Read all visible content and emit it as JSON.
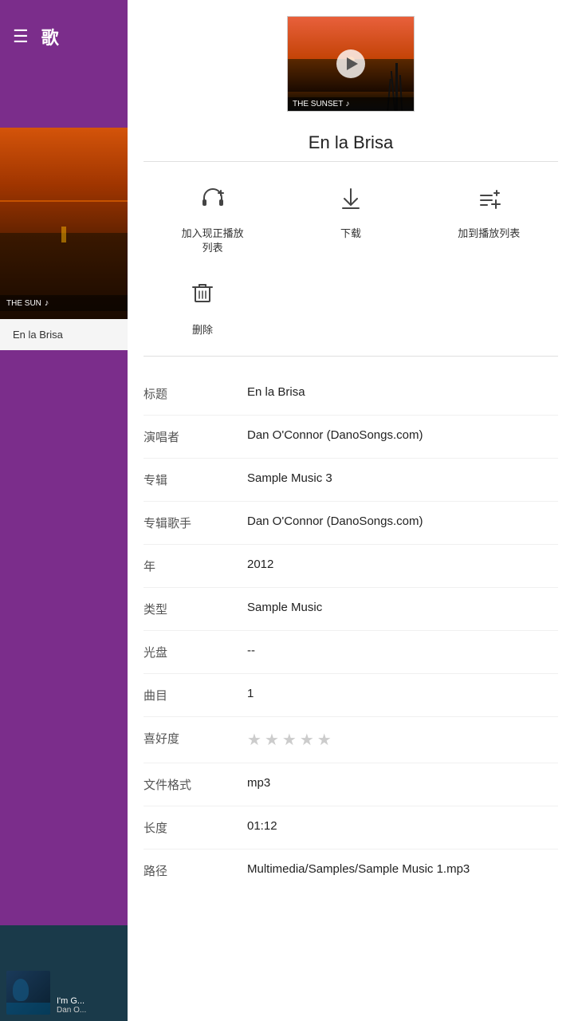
{
  "sidebar": {
    "menu_icon": "☰",
    "title": "歌",
    "album_label": "THE SUN",
    "album_song": "En la Brisa",
    "bottom_album_artist": "Dan O"
  },
  "album": {
    "label": "THE SUNSET",
    "music_note": "♪"
  },
  "song": {
    "title": "En la Brisa"
  },
  "actions": [
    {
      "label": "加入现正播放\n列表",
      "icon_name": "add-to-now-playing-icon"
    },
    {
      "label": "下载",
      "icon_name": "download-icon"
    },
    {
      "label": "加到播放列表",
      "icon_name": "add-to-playlist-icon"
    }
  ],
  "delete_action": {
    "label": "删除",
    "icon_name": "delete-icon"
  },
  "info": {
    "rows": [
      {
        "label": "标题",
        "value": "En la Brisa",
        "type": "text"
      },
      {
        "label": "演唱者",
        "value": "Dan O'Connor (DanoSongs.com)",
        "type": "text"
      },
      {
        "label": "专辑",
        "value": "Sample Music 3",
        "type": "text"
      },
      {
        "label": "专辑歌手",
        "value": "Dan O'Connor (DanoSongs.com)",
        "type": "text"
      },
      {
        "label": "年",
        "value": "2012",
        "type": "text"
      },
      {
        "label": "类型",
        "value": "Sample Music",
        "type": "text"
      },
      {
        "label": "光盘",
        "value": "--",
        "type": "text"
      },
      {
        "label": "曲目",
        "value": "1",
        "type": "text"
      },
      {
        "label": "喜好度",
        "value": "",
        "type": "stars"
      },
      {
        "label": "文件格式",
        "value": "mp3",
        "type": "text"
      },
      {
        "label": "长度",
        "value": "01:12",
        "type": "text"
      },
      {
        "label": "路径",
        "value": "Multimedia/Samples/Sample Music 1.mp3",
        "type": "text"
      }
    ]
  }
}
